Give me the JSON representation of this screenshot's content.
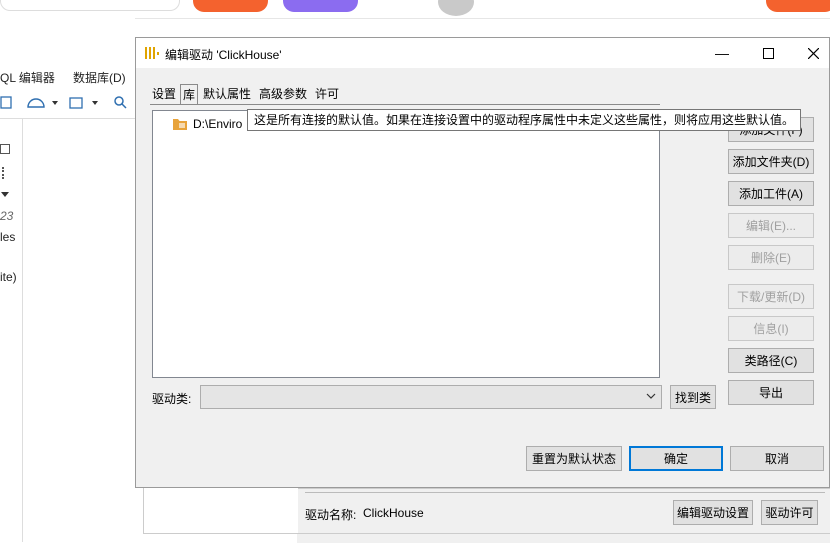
{
  "background_app": {
    "menu_sql_editor": "QL 编辑器",
    "menu_database": "数据库(D)",
    "tree_fragment_23": "23",
    "tree_fragment_les": "les",
    "tree_fragment_ite": "ite)",
    "driver_name_label": "驱动名称:",
    "driver_name_value": "ClickHouse",
    "edit_driver_settings": "编辑驱动设置",
    "driver_license": "驱动许可"
  },
  "dialog": {
    "title": "编辑驱动 'ClickHouse'",
    "tabs": [
      {
        "label": "设置"
      },
      {
        "label": "库"
      },
      {
        "label": "默认属性"
      },
      {
        "label": "高级参数"
      },
      {
        "label": "许可"
      }
    ],
    "library_item": "D:\\Enviro",
    "tooltip": "这是所有连接的默认值。如果在连接设置中的驱动程序属性中未定义这些属性，则将应用这些默认值。",
    "side_buttons": {
      "add_file": "添加文件(F)",
      "add_folder": "添加文件夹(D)",
      "add_artifact": "添加工件(A)",
      "edit": "编辑(E)...",
      "delete": "删除(E)",
      "download_update": "下载/更新(D)",
      "info": "信息(I)",
      "classpath": "类路径(C)",
      "export": "导出"
    },
    "driver_class_label": "驱动类:",
    "find_class": "找到类",
    "reset_defaults": "重置为默认状态",
    "ok": "确定",
    "cancel": "取消"
  },
  "colors": {
    "accent": "#0078d7",
    "folder": "#e8a33a",
    "pill_orange": "#f4622e",
    "pill_purple": "#8b6cf0"
  }
}
